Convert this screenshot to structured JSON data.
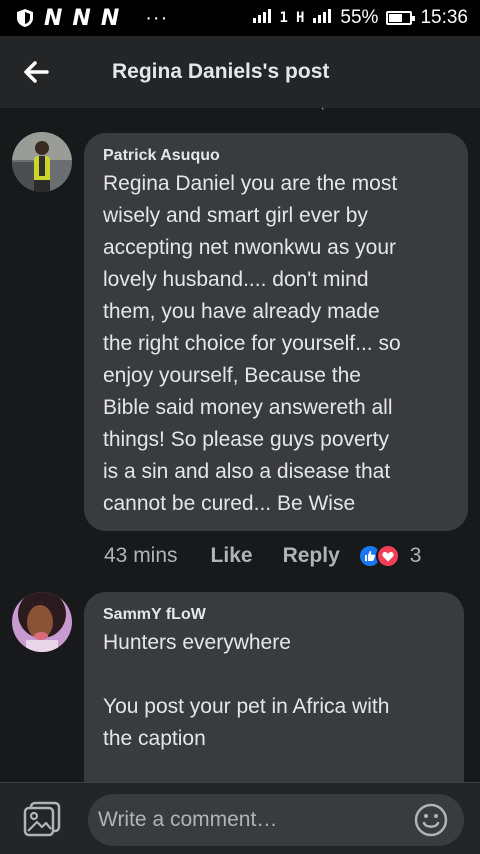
{
  "status_bar": {
    "carriers": [
      "N",
      "N",
      "N"
    ],
    "dots": "···",
    "sim1": "1",
    "sim2": "H",
    "battery_percent": "55%",
    "battery_level": 0.55,
    "time": "15:36"
  },
  "header": {
    "title": "Regina Daniels's post",
    "back_icon": "arrow-left-icon"
  },
  "partial_text": "·",
  "comments": [
    {
      "author": "Patrick Asuquo",
      "text": "Regina Daniel you are the most\nwisely and smart girl ever by\naccepting net nwonkwu as your\nlovely husband.... don't mind\nthem, you have already made\nthe right choice for yourself... so\nenjoy yourself, Because the\nBible said money answereth all\nthings! So please guys poverty\nis a sin and also a disease that\ncannot be cured... Be Wise",
      "time": "43 mins",
      "like_label": "Like",
      "reply_label": "Reply",
      "reactions": [
        "like",
        "love"
      ],
      "reaction_count": "3"
    },
    {
      "author": "SammY fLoW",
      "text": "Hunters everywhere\n\nYou post your pet in Africa with\nthe caption"
    }
  ],
  "composer": {
    "placeholder": "Write a comment…",
    "photo_icon": "photo-icon",
    "emoji_icon": "emoji-icon"
  },
  "colors": {
    "background": "#18191a",
    "bubble": "#3a3b3c",
    "header": "#242526",
    "like": "#1877f2",
    "love": "#f33e58"
  }
}
